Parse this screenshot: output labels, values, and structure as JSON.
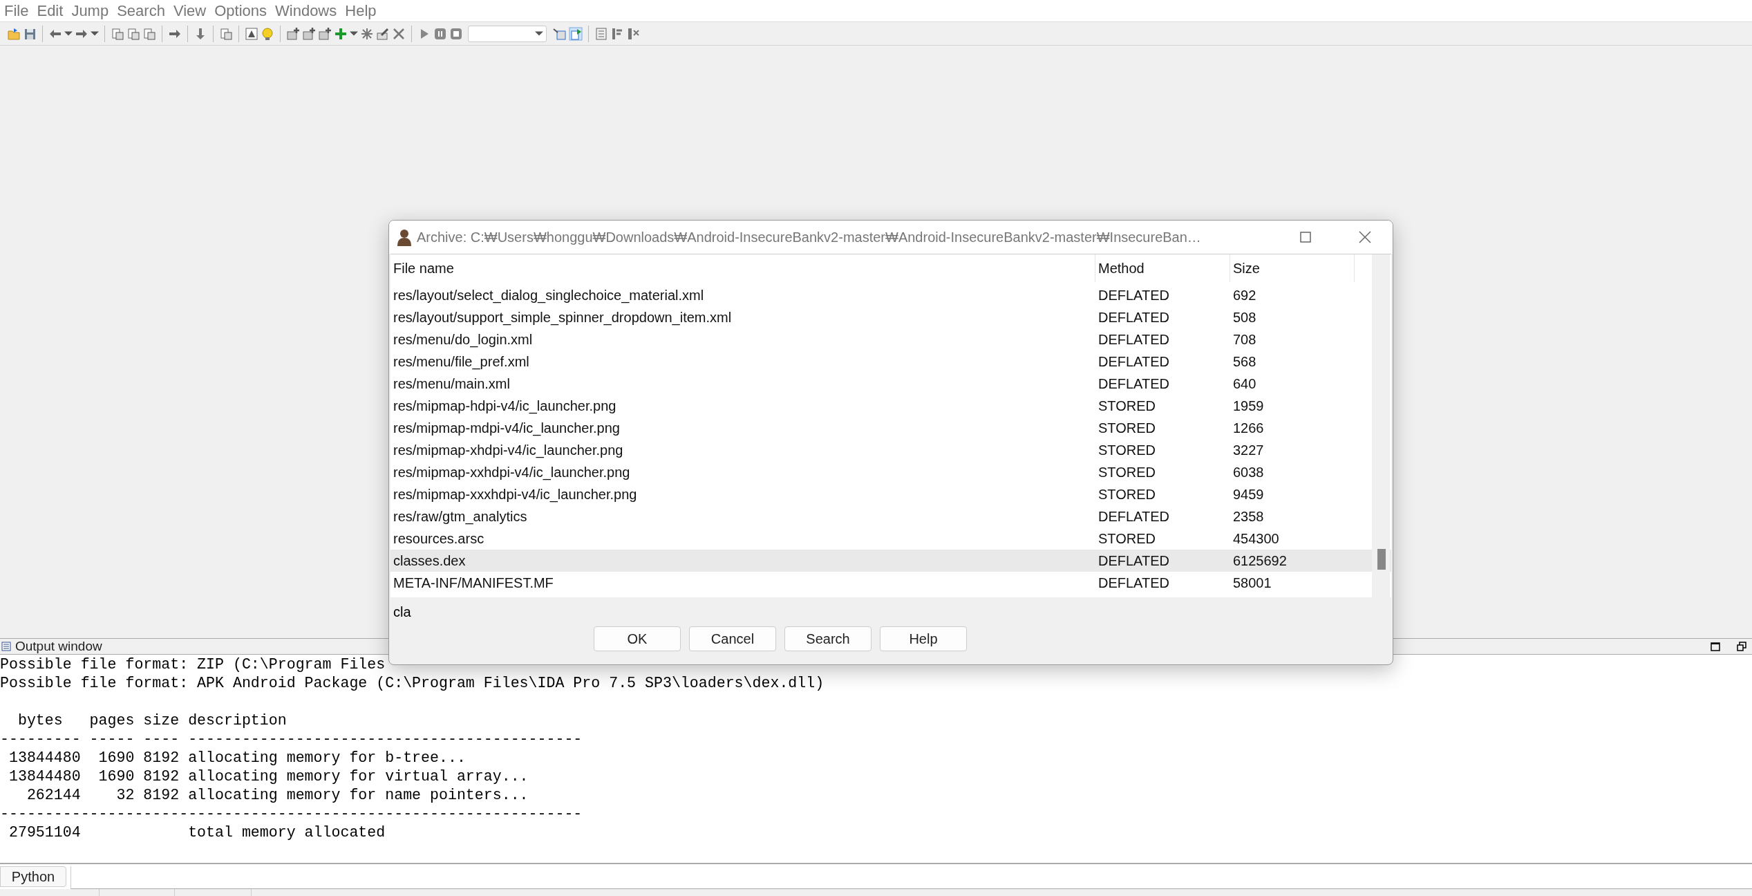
{
  "menu": [
    "File",
    "Edit",
    "Jump",
    "Search",
    "View",
    "Options",
    "Windows",
    "Help"
  ],
  "dialog": {
    "title": "Archive: C:₩Users₩honggu₩Downloads₩Android-InsecureBankv2-master₩Android-InsecureBankv2-master₩InsecureBan…",
    "columns": [
      "File name",
      "Method",
      "Size"
    ],
    "rows": [
      {
        "name": "res/layout/select_dialog_singlechoice_material.xml",
        "method": "DEFLATED",
        "size": "692",
        "selected": false
      },
      {
        "name": "res/layout/support_simple_spinner_dropdown_item.xml",
        "method": "DEFLATED",
        "size": "508",
        "selected": false
      },
      {
        "name": "res/menu/do_login.xml",
        "method": "DEFLATED",
        "size": "708",
        "selected": false
      },
      {
        "name": "res/menu/file_pref.xml",
        "method": "DEFLATED",
        "size": "568",
        "selected": false
      },
      {
        "name": "res/menu/main.xml",
        "method": "DEFLATED",
        "size": "640",
        "selected": false
      },
      {
        "name": "res/mipmap-hdpi-v4/ic_launcher.png",
        "method": "STORED",
        "size": "1959",
        "selected": false
      },
      {
        "name": "res/mipmap-mdpi-v4/ic_launcher.png",
        "method": "STORED",
        "size": "1266",
        "selected": false
      },
      {
        "name": "res/mipmap-xhdpi-v4/ic_launcher.png",
        "method": "STORED",
        "size": "3227",
        "selected": false
      },
      {
        "name": "res/mipmap-xxhdpi-v4/ic_launcher.png",
        "method": "STORED",
        "size": "6038",
        "selected": false
      },
      {
        "name": "res/mipmap-xxxhdpi-v4/ic_launcher.png",
        "method": "STORED",
        "size": "9459",
        "selected": false
      },
      {
        "name": "res/raw/gtm_analytics",
        "method": "DEFLATED",
        "size": "2358",
        "selected": false
      },
      {
        "name": "resources.arsc",
        "method": "STORED",
        "size": "454300",
        "selected": false
      },
      {
        "name": "classes.dex",
        "method": "DEFLATED",
        "size": "6125692",
        "selected": true
      },
      {
        "name": "META-INF/MANIFEST.MF",
        "method": "DEFLATED",
        "size": "58001",
        "selected": false
      }
    ],
    "filter": {
      "value": "cla"
    },
    "buttons": [
      "OK",
      "Cancel",
      "Search",
      "Help"
    ]
  },
  "output": {
    "title": "Output window",
    "messages": [
      "Possible file format: ZIP (C:\\Program Files",
      "Possible file format: APK Android Package (C:\\Program Files\\IDA Pro 7.5 SP3\\loaders\\dex.dll)"
    ],
    "memory_table": [
      "  bytes   pages size description",
      "--------- ----- ---- --------------------------------------------",
      " 13844480  1690 8192 allocating memory for b-tree...",
      " 13844480  1690 8192 allocating memory for virtual array...",
      "   262144    32 8192 allocating memory for name pointers...",
      "-----------------------------------------------------------------",
      " 27951104            total memory allocated"
    ]
  },
  "cli": {
    "tab": "Python"
  }
}
